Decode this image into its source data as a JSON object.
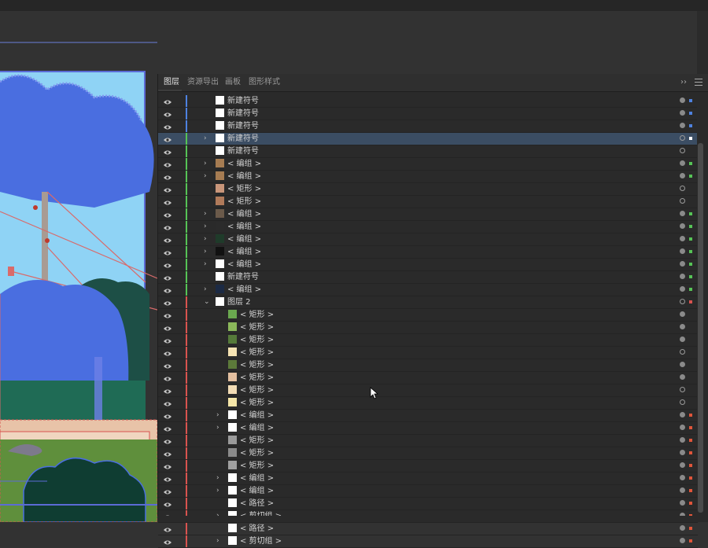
{
  "panel": {
    "tabs": [
      {
        "label": "图层",
        "active": true
      },
      {
        "label": "资源导出",
        "active": false
      },
      {
        "label": "画板",
        "active": false
      },
      {
        "label": "图形样式",
        "active": false
      }
    ],
    "collapse_glyph": "››"
  },
  "colors": {
    "layer1": "#4e82e0",
    "layer_green": "#56c456",
    "layer2": "#d9534f",
    "selected_row": "#3b4d63"
  },
  "layers": [
    {
      "label": "新建符号",
      "chevron": false,
      "indent": 0,
      "bar": "#4e82e0",
      "thumb": "#ffffff",
      "target": "filled",
      "swatch": "#4e82e0"
    },
    {
      "label": "新建符号",
      "chevron": false,
      "indent": 0,
      "bar": "#4e82e0",
      "thumb": "#ffffff",
      "target": "filled",
      "swatch": "#4e82e0"
    },
    {
      "label": "新建符号",
      "chevron": false,
      "indent": 0,
      "bar": "#4e82e0",
      "thumb": "#ffffff",
      "target": "filled",
      "swatch": "#4e82e0"
    },
    {
      "label": "新建符号",
      "chevron": true,
      "indent": 0,
      "bar": "#56c456",
      "thumb": "#ffffff",
      "target": "ring",
      "swatch": "#ffffff",
      "selected": true
    },
    {
      "label": "新建符号",
      "chevron": false,
      "indent": 0,
      "bar": "#56c456",
      "thumb": "#ffffff",
      "target": "ring",
      "swatch": ""
    },
    {
      "label": "< 编组 >",
      "chevron": true,
      "indent": 0,
      "bar": "#56c456",
      "thumb": "#a67c52",
      "target": "filled",
      "swatch": "#56c456"
    },
    {
      "label": "< 编组 >",
      "chevron": true,
      "indent": 0,
      "bar": "#56c456",
      "thumb": "#a67c52",
      "target": "filled",
      "swatch": "#56c456"
    },
    {
      "label": "< 矩形 >",
      "chevron": false,
      "indent": 0,
      "bar": "#56c456",
      "thumb": "#c9967a",
      "target": "ring",
      "swatch": ""
    },
    {
      "label": "< 矩形 >",
      "chevron": false,
      "indent": 0,
      "bar": "#56c456",
      "thumb": "#b07a5a",
      "target": "ring",
      "swatch": ""
    },
    {
      "label": "< 编组 >",
      "chevron": true,
      "indent": 0,
      "bar": "#56c456",
      "thumb": "#6b5a4a",
      "target": "filled",
      "swatch": "#56c456"
    },
    {
      "label": "< 编组 >",
      "chevron": true,
      "indent": 0,
      "bar": "#56c456",
      "thumb": "#2b2b2b",
      "target": "filled",
      "swatch": "#56c456"
    },
    {
      "label": "< 编组 >",
      "chevron": true,
      "indent": 0,
      "bar": "#56c456",
      "thumb": "#1f3b2a",
      "target": "filled",
      "swatch": "#56c456"
    },
    {
      "label": "< 编组 >",
      "chevron": true,
      "indent": 0,
      "bar": "#56c456",
      "thumb": "#111111",
      "target": "filled",
      "swatch": "#56c456"
    },
    {
      "label": "< 编组 >",
      "chevron": true,
      "indent": 0,
      "bar": "#56c456",
      "thumb": "#ffffff",
      "target": "filled",
      "swatch": "#56c456"
    },
    {
      "label": "新建符号",
      "chevron": false,
      "indent": 0,
      "bar": "#56c456",
      "thumb": "#ffffff",
      "target": "filled",
      "swatch": "#56c456"
    },
    {
      "label": "< 编组 >",
      "chevron": true,
      "indent": 0,
      "bar": "#56c456",
      "thumb": "#1c2a44",
      "target": "filled",
      "swatch": "#56c456"
    },
    {
      "label": "图层 2",
      "chevron": true,
      "open": true,
      "indent": 0,
      "bar": "#d9534f",
      "thumb": "#ffffff",
      "target": "ring",
      "swatch": "#d9534f"
    },
    {
      "label": "< 矩形 >",
      "chevron": false,
      "indent": 1,
      "bar": "#d9534f",
      "thumb": "#6aa84f",
      "target": "filled",
      "swatch": ""
    },
    {
      "label": "< 矩形 >",
      "chevron": false,
      "indent": 1,
      "bar": "#d9534f",
      "thumb": "#8bb85a",
      "target": "filled",
      "swatch": ""
    },
    {
      "label": "< 矩形 >",
      "chevron": false,
      "indent": 1,
      "bar": "#d9534f",
      "thumb": "#557a3a",
      "target": "filled",
      "swatch": ""
    },
    {
      "label": "< 矩形 >",
      "chevron": false,
      "indent": 1,
      "bar": "#d9534f",
      "thumb": "#f5e3b3",
      "target": "ring",
      "swatch": ""
    },
    {
      "label": "< 矩形 >",
      "chevron": false,
      "indent": 1,
      "bar": "#d9534f",
      "thumb": "#5c7a3a",
      "target": "filled",
      "swatch": ""
    },
    {
      "label": "< 矩形 >",
      "chevron": false,
      "indent": 1,
      "bar": "#d9534f",
      "thumb": "#e3bfa0",
      "target": "filled",
      "swatch": ""
    },
    {
      "label": "< 矩形 >",
      "chevron": false,
      "indent": 1,
      "bar": "#d9534f",
      "thumb": "#f2dcb5",
      "target": "ring",
      "swatch": ""
    },
    {
      "label": "< 矩形 >",
      "chevron": false,
      "indent": 1,
      "bar": "#d9534f",
      "thumb": "#f5e6a8",
      "target": "ring",
      "swatch": ""
    },
    {
      "label": "< 编组 >",
      "chevron": true,
      "indent": 1,
      "bar": "#d9534f",
      "thumb": "#ffffff",
      "target": "filled",
      "swatch": "#e0553a"
    },
    {
      "label": "< 编组 >",
      "chevron": true,
      "indent": 1,
      "bar": "#d9534f",
      "thumb": "#ffffff",
      "target": "filled",
      "swatch": "#e0553a"
    },
    {
      "label": "< 矩形 >",
      "chevron": false,
      "indent": 1,
      "bar": "#d9534f",
      "thumb": "#9a9a9a",
      "target": "filled",
      "swatch": "#e0553a"
    },
    {
      "label": "< 矩形 >",
      "chevron": false,
      "indent": 1,
      "bar": "#d9534f",
      "thumb": "#8a8a8a",
      "target": "filled",
      "swatch": "#e0553a"
    },
    {
      "label": "< 矩形 >",
      "chevron": false,
      "indent": 1,
      "bar": "#d9534f",
      "thumb": "#a0a0a0",
      "target": "filled",
      "swatch": "#e0553a"
    },
    {
      "label": "< 编组 >",
      "chevron": true,
      "indent": 1,
      "bar": "#d9534f",
      "thumb": "#ffffff",
      "target": "filled",
      "swatch": "#e0553a"
    },
    {
      "label": "< 编组 >",
      "chevron": true,
      "indent": 1,
      "bar": "#d9534f",
      "thumb": "#ffffff",
      "target": "filled",
      "swatch": "#e0553a"
    },
    {
      "label": "< 路径 >",
      "chevron": false,
      "indent": 1,
      "bar": "#d9534f",
      "thumb": "#ffffff",
      "target": "filled",
      "swatch": "#e0553a"
    },
    {
      "label": "< 剪切组 >",
      "chevron": true,
      "indent": 1,
      "bar": "#d9534f",
      "thumb": "#ffffff",
      "target": "filled",
      "swatch": "#e0553a"
    },
    {
      "label": "< 路径 >",
      "chevron": false,
      "indent": 1,
      "bar": "#d9534f",
      "thumb": "#ffffff",
      "target": "filled",
      "swatch": "#e0553a"
    },
    {
      "label": "< 剪切组 >",
      "chevron": true,
      "indent": 1,
      "bar": "#d9534f",
      "thumb": "#ffffff",
      "target": "filled",
      "swatch": "#e0553a"
    }
  ]
}
